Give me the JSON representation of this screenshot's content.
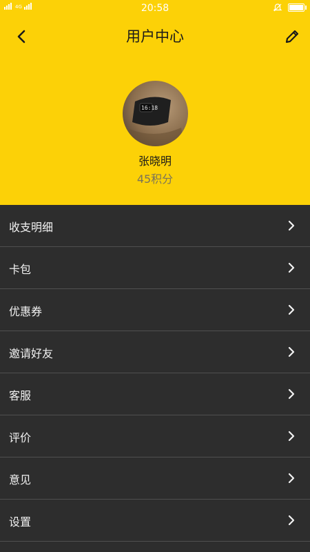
{
  "status_bar": {
    "network": "4G",
    "time": "20:58",
    "battery_level": 1.0
  },
  "header": {
    "title": "用户中心",
    "back_icon": "chevron-left-icon",
    "edit_icon": "pencil-icon"
  },
  "profile": {
    "name": "张晓明",
    "points": "45积分"
  },
  "menu": {
    "items": [
      {
        "label": "收支明细"
      },
      {
        "label": "卡包"
      },
      {
        "label": "优惠券"
      },
      {
        "label": "邀请好友"
      },
      {
        "label": "客服"
      },
      {
        "label": "评价"
      },
      {
        "label": "意见"
      },
      {
        "label": "设置"
      }
    ]
  },
  "colors": {
    "header_bg": "#fcd107",
    "menu_bg": "#2d2d2d",
    "divider": "#505050"
  }
}
